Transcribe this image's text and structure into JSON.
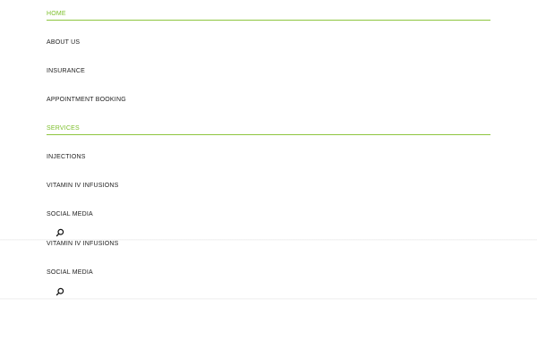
{
  "menu": {
    "items": [
      {
        "label": "HOME",
        "active": true
      },
      {
        "label": "ABOUT US",
        "active": false
      },
      {
        "label": "INSURANCE",
        "active": false
      },
      {
        "label": "APPOINTMENT BOOKING",
        "active": false
      },
      {
        "label": "SERVICES",
        "active": true
      },
      {
        "label": "INJECTIONS",
        "active": false
      },
      {
        "label": "VITAMIN IV INFUSIONS",
        "active": false
      },
      {
        "label": "SOCIAL MEDIA",
        "active": false
      }
    ],
    "search_icon": "search-icon"
  },
  "lower_menu": {
    "items": [
      {
        "label": "VITAMIN IV INFUSIONS"
      },
      {
        "label": "SOCIAL MEDIA"
      }
    ],
    "search_icon": "search-icon"
  },
  "colors": {
    "accent": "#8ec63f",
    "accent_text": "#7cbf2a",
    "text": "#222222",
    "background": "#ffffff"
  }
}
